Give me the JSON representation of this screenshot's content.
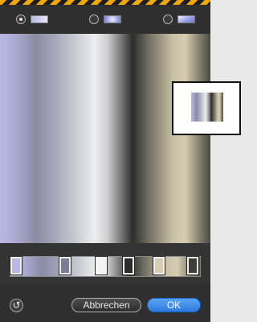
{
  "gradient_types": [
    {
      "name": "linear",
      "selected": true
    },
    {
      "name": "radial",
      "selected": false
    },
    {
      "name": "angle",
      "selected": false
    }
  ],
  "color_stops": [
    {
      "color": "#b9b9e5",
      "position": 0.03
    },
    {
      "color": "#7c7c98",
      "position": 0.29
    },
    {
      "color": "#f4f4f4",
      "position": 0.48
    },
    {
      "color": "#2b2b29",
      "position": 0.62
    },
    {
      "color": "#d8cdb3",
      "position": 0.78
    },
    {
      "color": "#3f3e39",
      "position": 0.96
    }
  ],
  "buttons": {
    "reset_glyph": "↺",
    "cancel_label": "Abbrechen",
    "ok_label": "OK"
  },
  "colors": {
    "accent": "#2f79df",
    "hazard_yellow": "#f1a900"
  }
}
